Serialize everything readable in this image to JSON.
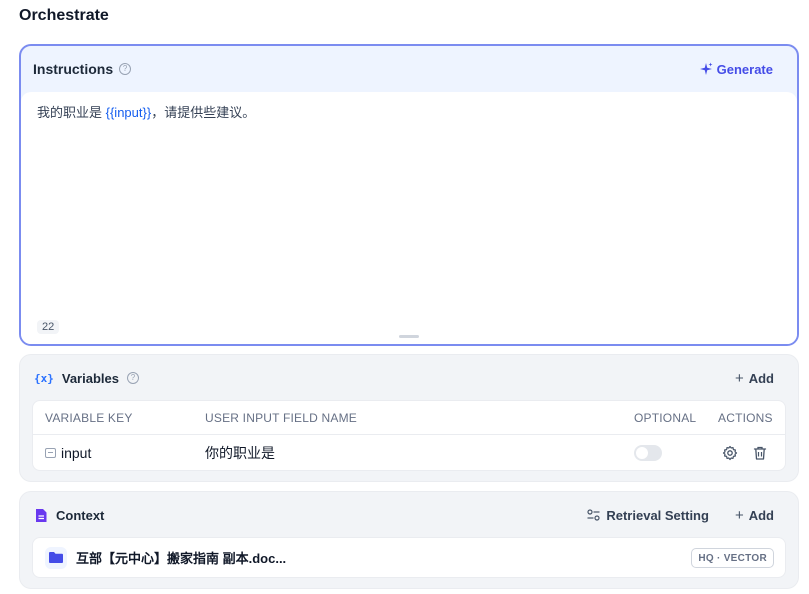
{
  "page": {
    "title": "Orchestrate"
  },
  "instructions": {
    "title": "Instructions",
    "generate_label": "Generate",
    "prompt_prefix": "我的职业是 ",
    "prompt_variable": "{{input}}",
    "prompt_suffix": "，请提供些建议。",
    "char_count": "22"
  },
  "variables": {
    "title": "Variables",
    "icon_glyph": "{x}",
    "add_label": "Add",
    "columns": {
      "key": "VARIABLE KEY",
      "name": "USER INPUT FIELD NAME",
      "optional": "OPTIONAL",
      "actions": "ACTIONS"
    },
    "rows": [
      {
        "key": "input",
        "name": "你的职业是",
        "optional": false
      }
    ]
  },
  "context": {
    "title": "Context",
    "retrieval_label": "Retrieval Setting",
    "add_label": "Add",
    "datasets": [
      {
        "name": "互部【元中心】搬家指南 副本.doc...",
        "badge": "HQ · VECTOR"
      }
    ]
  },
  "colors": {
    "accent": "#444ce7",
    "variable": "#155eef",
    "border_active": "#7b8cf0"
  }
}
